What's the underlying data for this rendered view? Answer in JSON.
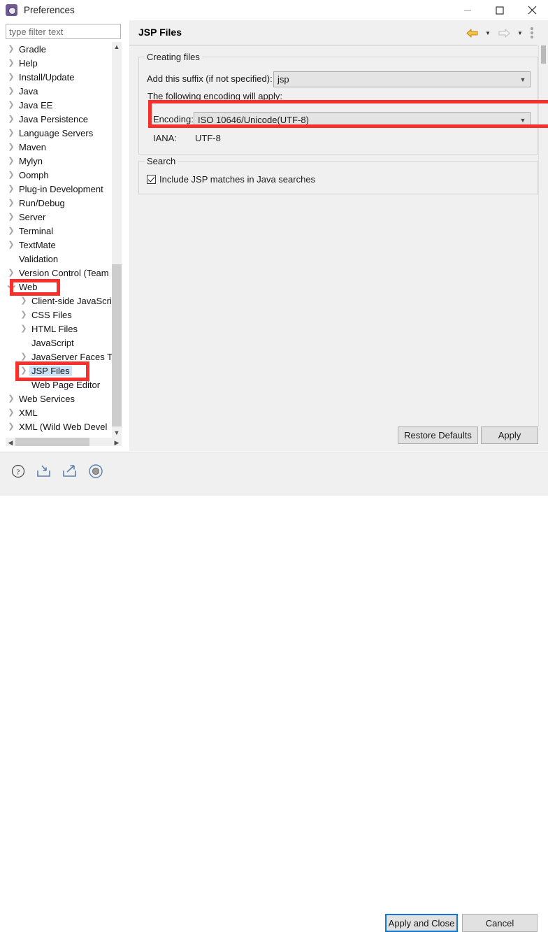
{
  "window": {
    "title": "Preferences",
    "icon": "preferences-gear-icon",
    "minimize": "minimize-icon",
    "maximize": "maximize-icon",
    "close": "close-icon"
  },
  "filter": {
    "placeholder": "type filter text",
    "value": ""
  },
  "tree": {
    "items": [
      {
        "label": "Gradle",
        "expandable": true,
        "expanded": false,
        "indent": 0,
        "selected": false
      },
      {
        "label": "Help",
        "expandable": true,
        "expanded": false,
        "indent": 0,
        "selected": false
      },
      {
        "label": "Install/Update",
        "expandable": true,
        "expanded": false,
        "indent": 0,
        "selected": false
      },
      {
        "label": "Java",
        "expandable": true,
        "expanded": false,
        "indent": 0,
        "selected": false
      },
      {
        "label": "Java EE",
        "expandable": true,
        "expanded": false,
        "indent": 0,
        "selected": false
      },
      {
        "label": "Java Persistence",
        "expandable": true,
        "expanded": false,
        "indent": 0,
        "selected": false
      },
      {
        "label": "Language Servers",
        "expandable": true,
        "expanded": false,
        "indent": 0,
        "selected": false
      },
      {
        "label": "Maven",
        "expandable": true,
        "expanded": false,
        "indent": 0,
        "selected": false
      },
      {
        "label": "Mylyn",
        "expandable": true,
        "expanded": false,
        "indent": 0,
        "selected": false
      },
      {
        "label": "Oomph",
        "expandable": true,
        "expanded": false,
        "indent": 0,
        "selected": false
      },
      {
        "label": "Plug-in Development",
        "expandable": true,
        "expanded": false,
        "indent": 0,
        "selected": false
      },
      {
        "label": "Run/Debug",
        "expandable": true,
        "expanded": false,
        "indent": 0,
        "selected": false
      },
      {
        "label": "Server",
        "expandable": true,
        "expanded": false,
        "indent": 0,
        "selected": false
      },
      {
        "label": "Terminal",
        "expandable": true,
        "expanded": false,
        "indent": 0,
        "selected": false
      },
      {
        "label": "TextMate",
        "expandable": true,
        "expanded": false,
        "indent": 0,
        "selected": false
      },
      {
        "label": "Validation",
        "expandable": false,
        "expanded": false,
        "indent": 0,
        "selected": false
      },
      {
        "label": "Version Control (Team",
        "expandable": true,
        "expanded": false,
        "indent": 0,
        "selected": false
      },
      {
        "label": "Web",
        "expandable": true,
        "expanded": true,
        "indent": 0,
        "selected": false
      },
      {
        "label": "Client-side JavaScri",
        "expandable": true,
        "expanded": false,
        "indent": 1,
        "selected": false
      },
      {
        "label": "CSS Files",
        "expandable": true,
        "expanded": false,
        "indent": 1,
        "selected": false
      },
      {
        "label": "HTML Files",
        "expandable": true,
        "expanded": false,
        "indent": 1,
        "selected": false
      },
      {
        "label": "JavaScript",
        "expandable": false,
        "expanded": false,
        "indent": 1,
        "selected": false
      },
      {
        "label": "JavaServer Faces To",
        "expandable": true,
        "expanded": false,
        "indent": 1,
        "selected": false
      },
      {
        "label": "JSP Files",
        "expandable": true,
        "expanded": false,
        "indent": 1,
        "selected": true
      },
      {
        "label": "Web Page Editor",
        "expandable": false,
        "expanded": false,
        "indent": 1,
        "selected": false
      },
      {
        "label": "Web Services",
        "expandable": true,
        "expanded": false,
        "indent": 0,
        "selected": false
      },
      {
        "label": "XML",
        "expandable": true,
        "expanded": false,
        "indent": 0,
        "selected": false
      },
      {
        "label": "XML (Wild Web Devel",
        "expandable": true,
        "expanded": false,
        "indent": 0,
        "selected": false
      }
    ]
  },
  "page": {
    "title": "JSP Files",
    "nav": {
      "back": "back-arrow-icon",
      "back_menu": "back-dropdown-icon",
      "forward": "forward-arrow-icon",
      "forward_menu": "forward-dropdown-icon",
      "view_menu": "view-menu-icon"
    },
    "creating_files": {
      "legend": "Creating files",
      "suffix_label": "Add this suffix (if not specified):",
      "suffix_value": "jsp",
      "encoding_note": "The following encoding will apply:",
      "encoding_label": "Encoding:",
      "encoding_value": "ISO 10646/Unicode(UTF-8)",
      "iana_label": "IANA:",
      "iana_value": "UTF-8"
    },
    "search": {
      "legend": "Search",
      "checkbox_label": "Include JSP matches in Java searches",
      "checkbox_checked": true
    },
    "buttons": {
      "restore_defaults": "Restore Defaults",
      "apply": "Apply"
    }
  },
  "footer": {
    "icons": [
      {
        "name": "help-icon"
      },
      {
        "name": "import-icon"
      },
      {
        "name": "export-icon"
      },
      {
        "name": "record-icon"
      }
    ],
    "apply_and_close": "Apply and Close",
    "cancel": "Cancel"
  },
  "annotations": {
    "highlight_color": "#f8302b",
    "boxes": [
      "web-tree-node",
      "jsp-files-tree-node",
      "encoding-combo-row"
    ]
  },
  "colors": {
    "selection_blue": "#cde3f7",
    "focus_blue": "#1477d4",
    "panel_gray": "#f0f0f0",
    "control_gray": "#e1e1e1"
  }
}
